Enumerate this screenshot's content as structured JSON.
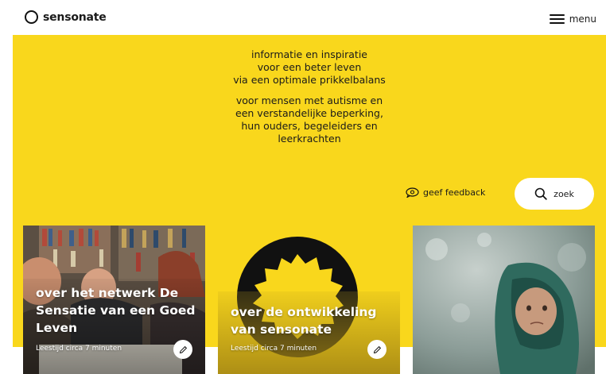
{
  "header": {
    "logo_text": "sensonate",
    "menu_label": "menu"
  },
  "hero": {
    "tagline_1": [
      "informatie en inspiratie",
      "voor een beter leven",
      "via een optimale prikkelbalans"
    ],
    "tagline_2": [
      "voor mensen met autisme en",
      "een verstandelijke beperking,",
      "hun ouders, begeleiders en",
      "leerkrachten"
    ],
    "feedback_label": "geef feedback",
    "search_label": "zoek"
  },
  "cards": [
    {
      "title": "over het netwerk De Sensatie van een Goed Leven",
      "meta": "Leestijd circa 7 minuten"
    },
    {
      "title": "over de ontwikkeling van sensonate",
      "meta": "Leestijd circa 7 minuten"
    },
    {
      "title": "",
      "meta": ""
    }
  ],
  "colors": {
    "accent": "#f9d71c",
    "text": "#1a1a1a",
    "background": "#ffffff"
  },
  "icons": [
    "logo-ring-icon",
    "hamburger-icon",
    "feedback-icon",
    "search-icon",
    "pencil-icon"
  ]
}
